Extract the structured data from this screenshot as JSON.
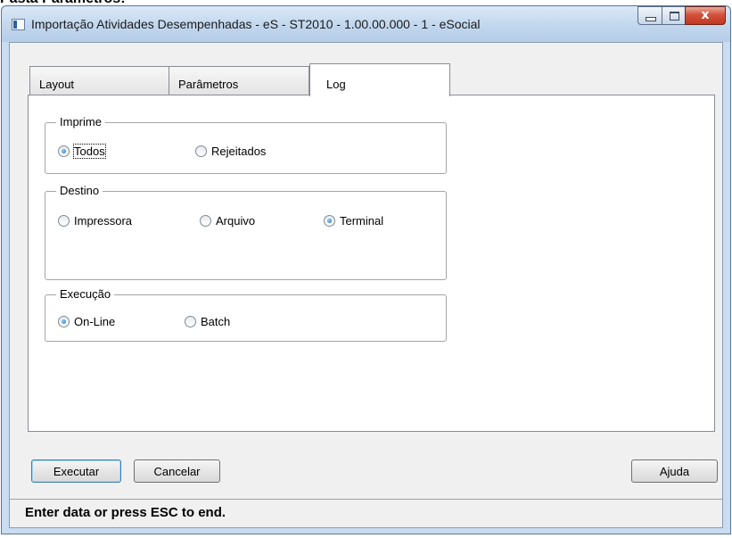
{
  "document": {
    "heading": "Pasta Parâmetros:"
  },
  "window": {
    "title": "Importação Atividades Desempenhadas - eS - ST2010 - 1.00.00.000 - 1 - eSocial",
    "buttons": {
      "minimize": "minimize",
      "maximize": "maximize",
      "close": "x"
    }
  },
  "tabs": [
    {
      "label": "Layout",
      "active": false
    },
    {
      "label": "Parâmetros",
      "active": false
    },
    {
      "label": "Log",
      "active": true
    }
  ],
  "groups": {
    "imprime": {
      "label": "Imprime",
      "options": [
        {
          "label": "Todos",
          "selected": true
        },
        {
          "label": "Rejeitados",
          "selected": false
        }
      ]
    },
    "destino": {
      "label": "Destino",
      "options": [
        {
          "label": "Impressora",
          "selected": false
        },
        {
          "label": "Arquivo",
          "selected": false
        },
        {
          "label": "Terminal",
          "selected": true
        }
      ]
    },
    "execucao": {
      "label": "Execução",
      "options": [
        {
          "label": "On-Line",
          "selected": true
        },
        {
          "label": "Batch",
          "selected": false
        }
      ]
    }
  },
  "buttons": {
    "executar": "Executar",
    "cancelar": "Cancelar",
    "ajuda": "Ajuda"
  },
  "status": "Enter data or press ESC to end."
}
